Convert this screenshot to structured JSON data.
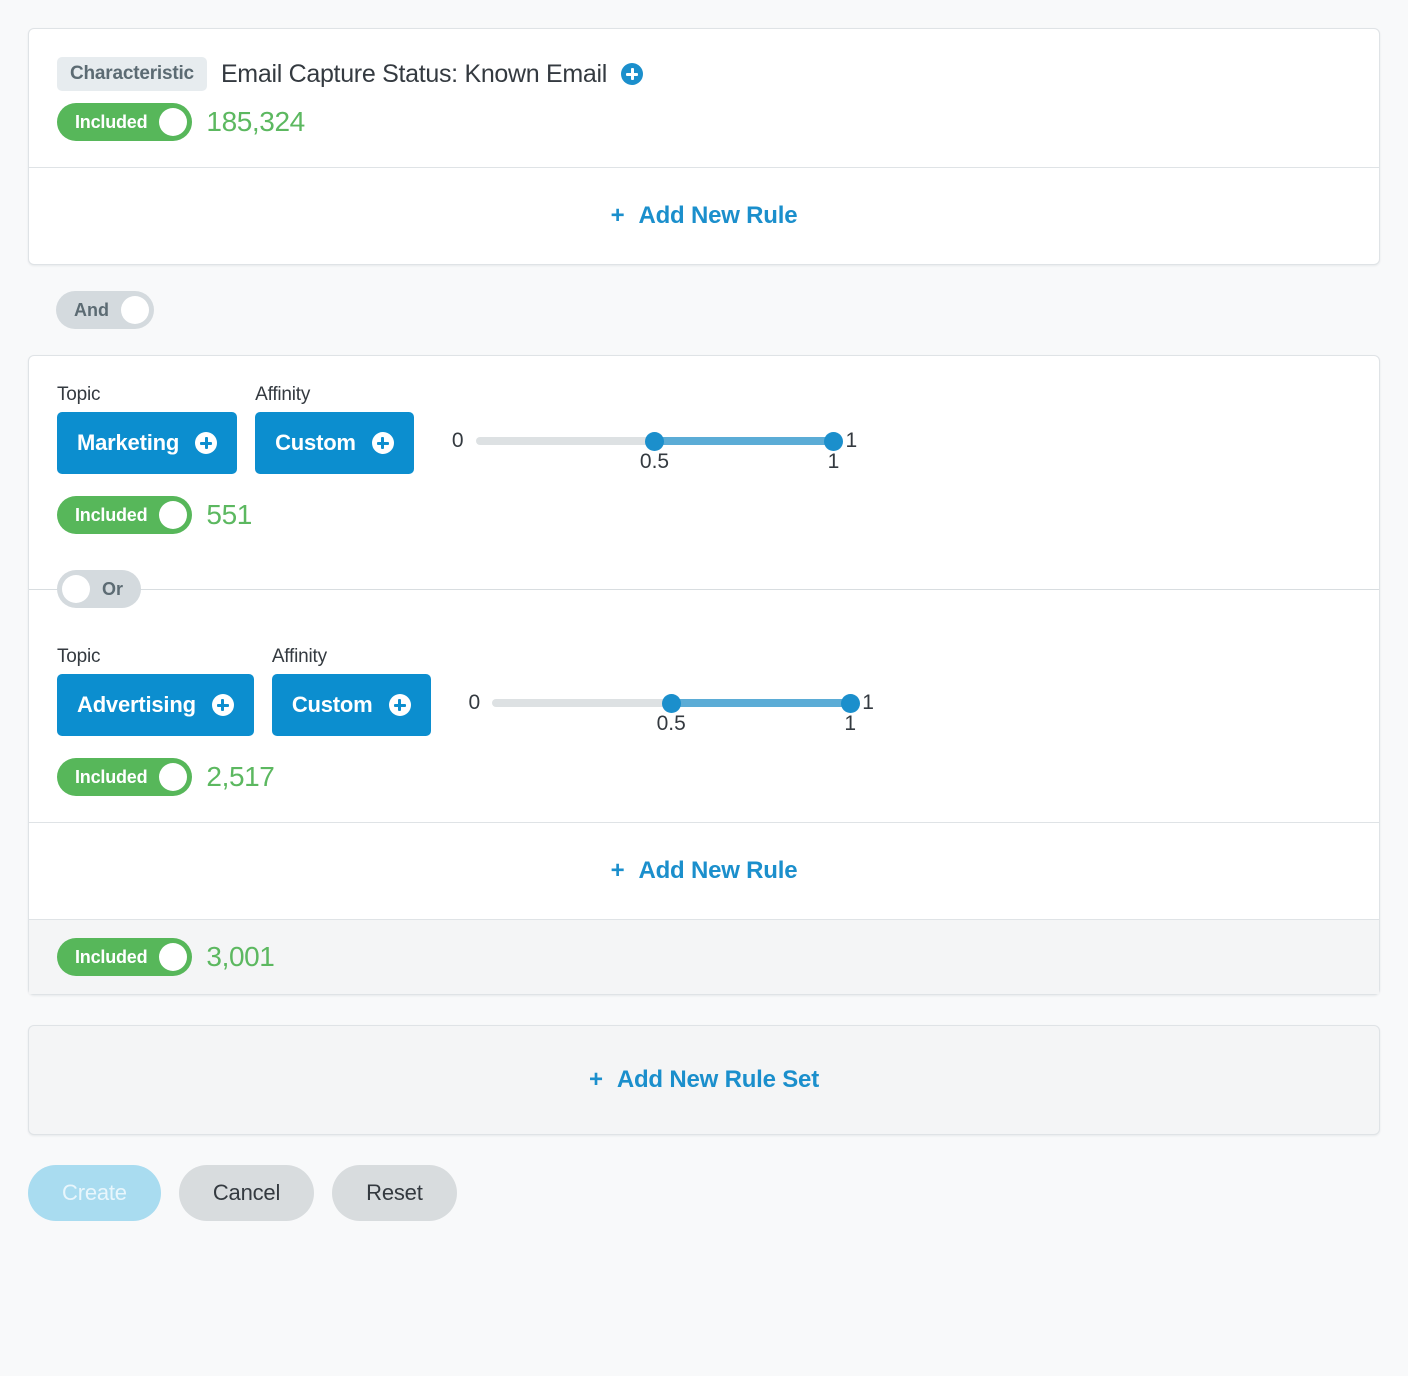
{
  "rule_set_1": {
    "badge": "Characteristic",
    "title": "Email Capture Status: Known Email",
    "add_icon": "plus-circle-icon",
    "inclusion": {
      "label": "Included",
      "count": "185,324"
    },
    "add_rule_label": "Add New Rule",
    "add_rule_plus": "+"
  },
  "connector_and": {
    "label": "And"
  },
  "rule_set_2": {
    "rules": [
      {
        "topic_label": "Topic",
        "topic_value": "Marketing",
        "affinity_label": "Affinity",
        "affinity_value": "Custom",
        "slider": {
          "min_label": "0",
          "max_label": "1",
          "low_tick": "0.5",
          "high_tick": "1",
          "low_value": 0.5,
          "high_value": 1
        },
        "inclusion": {
          "label": "Included",
          "count": "551"
        }
      },
      {
        "topic_label": "Topic",
        "topic_value": "Advertising",
        "affinity_label": "Affinity",
        "affinity_value": "Custom",
        "slider": {
          "min_label": "0",
          "max_label": "1",
          "low_tick": "0.5",
          "high_tick": "1",
          "low_value": 0.5,
          "high_value": 1
        },
        "inclusion": {
          "label": "Included",
          "count": "2,517"
        }
      }
    ],
    "connector_or": {
      "label": "Or"
    },
    "add_rule_label": "Add New Rule",
    "add_rule_plus": "+",
    "summary": {
      "label": "Included",
      "count": "3,001"
    }
  },
  "add_rule_set": {
    "plus": "+",
    "label": "Add New Rule Set"
  },
  "footer": {
    "create_label": "Create",
    "cancel_label": "Cancel",
    "reset_label": "Reset"
  },
  "colors": {
    "accent_blue": "#1b8fcc",
    "pill_blue": "#0c8ecf",
    "included_green": "#57b75a",
    "count_green": "#5cb860",
    "toggle_grey": "#d4dade",
    "page_bg": "#f8f9fa"
  }
}
